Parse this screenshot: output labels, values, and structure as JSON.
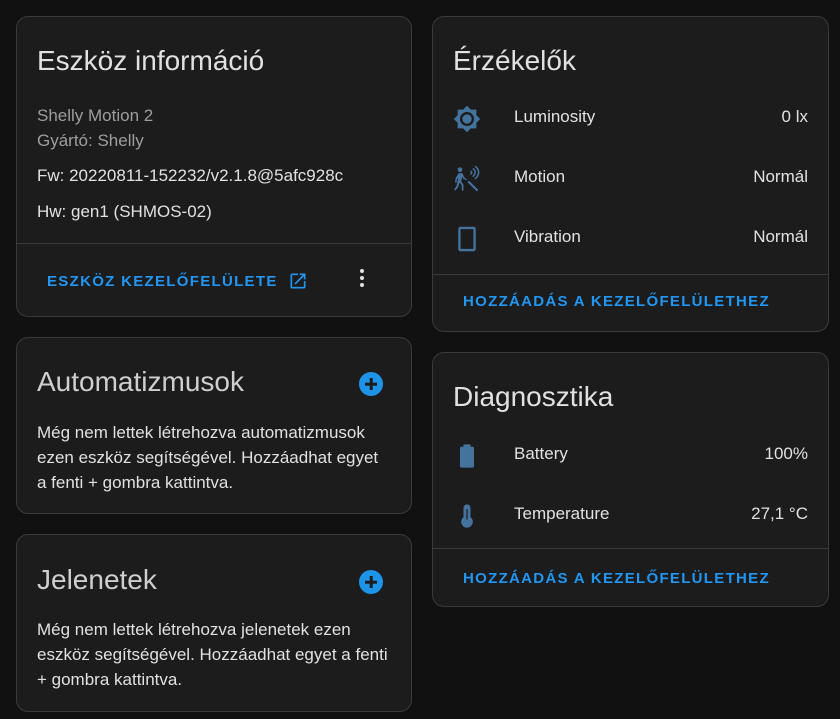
{
  "device_info": {
    "title": "Eszköz információ",
    "model": "Shelly Motion 2",
    "manufacturer": "Gyártó: Shelly",
    "firmware": "Fw: 20220811-152232/v2.1.8@5afc928c",
    "hardware": "Hw: gen1 (SHMOS-02)",
    "visit_label": "ESZKÖZ KEZELŐFELÜLETE",
    "visit_icon": "open-in-new-icon",
    "menu_icon": "dots-vertical-icon"
  },
  "automations": {
    "title": "Automatizmusok",
    "empty_text": "Még nem lettek létrehozva automatizmusok ezen eszköz segítségével. Hozzáadhat egyet a fenti + gombra kattintva.",
    "add_icon": "plus-circle-icon"
  },
  "scenes": {
    "title": "Jelenetek",
    "empty_text": "Még nem lettek létrehozva jelenetek ezen eszköz segítségével. Hozzáadhat egyet a fenti + gombra kattintva.",
    "add_icon": "plus-circle-icon"
  },
  "sensors": {
    "title": "Érzékelők",
    "items": [
      {
        "label": "Luminosity",
        "value": "0 lx",
        "icon": "brightness-icon"
      },
      {
        "label": "Motion",
        "value": "Normál",
        "icon": "motion-sensor-icon"
      },
      {
        "label": "Vibration",
        "value": "Normál",
        "icon": "vibration-icon"
      }
    ],
    "add_label": "HOZZÁADÁS A KEZELŐFELÜLETHEZ"
  },
  "diagnostics": {
    "title": "Diagnosztika",
    "items": [
      {
        "label": "Battery",
        "value": "100%",
        "icon": "battery-icon"
      },
      {
        "label": "Temperature",
        "value": "27,1 °C",
        "icon": "thermometer-icon"
      }
    ],
    "add_label": "HOZZÁADÁS A KEZELŐFELÜLETHEZ"
  },
  "colors": {
    "background": "#111111",
    "card": "#1c1c1c",
    "accent": "#2196f3",
    "icon": "#44739e"
  }
}
